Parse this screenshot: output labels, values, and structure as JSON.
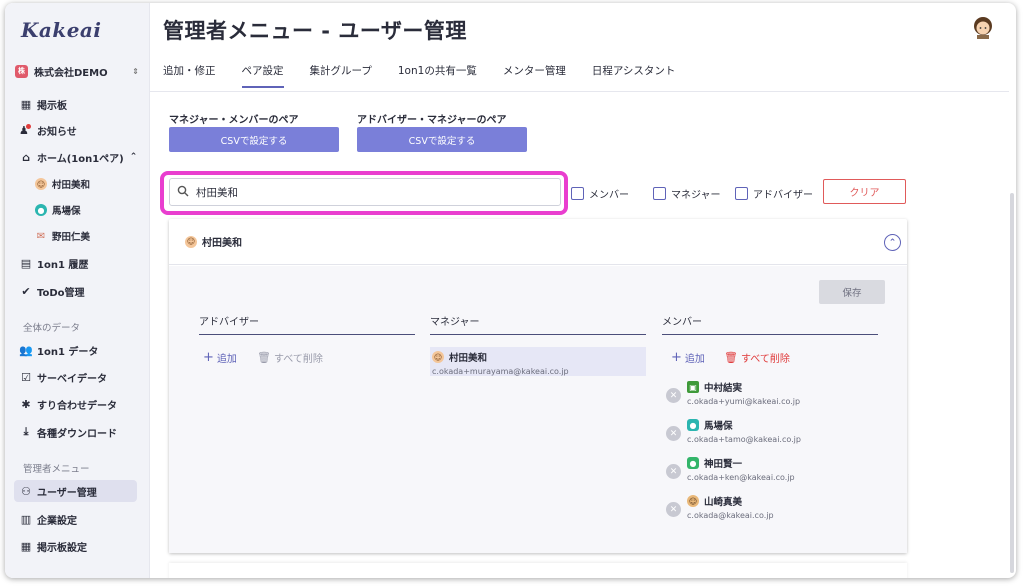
{
  "app": {
    "logo": "Kakeai"
  },
  "sidebar": {
    "company": {
      "badge": "株",
      "name": "株式会社DEMO",
      "switch_icon": "updown-chevron-icon"
    },
    "items": [
      {
        "label": "掲示板",
        "icon": "board-icon"
      },
      {
        "label": "お知らせ",
        "icon": "bell-icon"
      },
      {
        "label": "ホーム(1on1ペア)",
        "icon": "home-icon"
      }
    ],
    "home_members": [
      {
        "name": "村田美和",
        "icon": "avatar-face"
      },
      {
        "name": "馬場保",
        "icon": "avatar-teal"
      },
      {
        "name": "野田仁美",
        "icon": "avatar-mail"
      }
    ],
    "items2": [
      {
        "label": "1on1 履歴",
        "icon": "history-icon"
      },
      {
        "label": "ToDo管理",
        "icon": "check-circle-icon"
      }
    ],
    "section_data": "全体のデータ",
    "data_items": [
      {
        "label": "1on1 データ",
        "icon": "people-icon"
      },
      {
        "label": "サーベイデータ",
        "icon": "survey-icon"
      },
      {
        "label": "すり合わせデータ",
        "icon": "puzzle-icon"
      },
      {
        "label": "各種ダウンロード",
        "icon": "download-icon"
      }
    ],
    "section_admin": "管理者メニュー",
    "admin_items": [
      {
        "label": "ユーザー管理",
        "icon": "user-manage-icon",
        "active": true
      },
      {
        "label": "企業設定",
        "icon": "building-icon"
      },
      {
        "label": "掲示板設定",
        "icon": "board-icon"
      }
    ]
  },
  "header": {
    "title": "管理者メニュー - ユーザー管理"
  },
  "tabs": [
    {
      "label": "追加・修正"
    },
    {
      "label": "ペア設定",
      "active": true
    },
    {
      "label": "集計グループ"
    },
    {
      "label": "1on1の共有一覧"
    },
    {
      "label": "メンター管理"
    },
    {
      "label": "日程アシスタント"
    }
  ],
  "pairs": {
    "manager_member": {
      "label": "マネジャー・メンバーのペア",
      "button": "CSVで設定する"
    },
    "advisor_manager": {
      "label": "アドバイザー・マネジャーのペア",
      "button": "CSVで設定する"
    }
  },
  "search": {
    "value": "村田美和",
    "placeholder": ""
  },
  "filters": {
    "member": "メンバー",
    "manager": "マネジャー",
    "advisor": "アドバイザー",
    "clear": "クリア"
  },
  "card": {
    "user_name": "村田美和",
    "save": "保存",
    "columns": {
      "advisor": "アドバイザー",
      "manager": "マネジャー",
      "member": "メンバー"
    },
    "add": "追加",
    "delete_all": "すべて削除",
    "manager": {
      "name": "村田美和",
      "email": "c.okada+murayama@kakeai.co.jp"
    },
    "members": [
      {
        "name": "中村結実",
        "email": "c.okada+yumi@kakeai.co.jp",
        "avatar_color": "#3f9a3a"
      },
      {
        "name": "馬場保",
        "email": "c.okada+tamo@kakeai.co.jp",
        "avatar_color": "#2bb5b0"
      },
      {
        "name": "神田賢一",
        "email": "c.okada+ken@kakeai.co.jp",
        "avatar_color": "#33b56a"
      },
      {
        "name": "山崎真美",
        "email": "c.okada@kakeai.co.jp",
        "avatar_color": "#e9b879"
      }
    ]
  },
  "colors": {
    "accent": "#7a7fd9",
    "highlight": "#e93ecf",
    "danger": "#e05a5a"
  }
}
